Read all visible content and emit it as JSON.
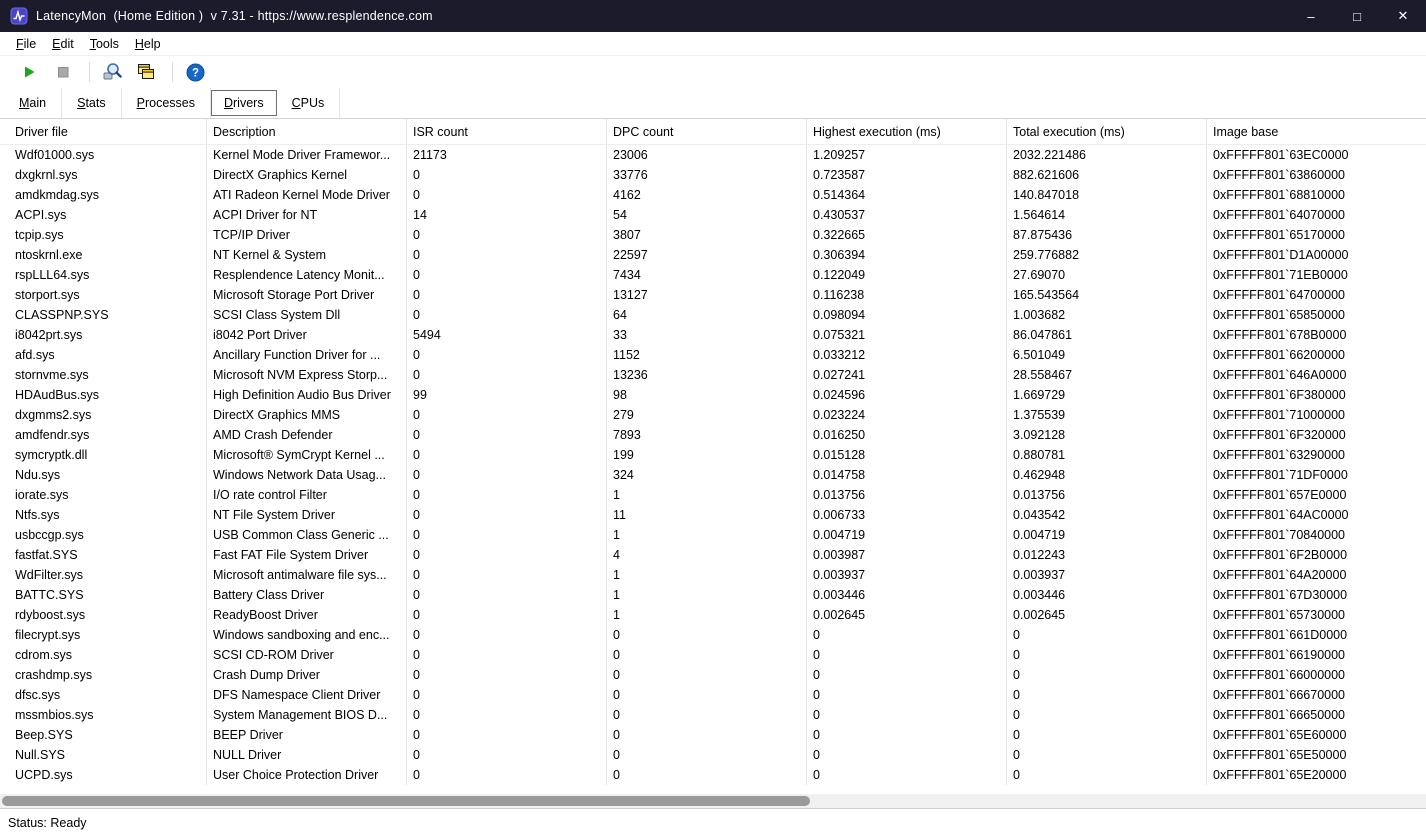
{
  "window": {
    "title": "LatencyMon  (Home Edition )  v 7.31 - https://www.resplendence.com",
    "controls": {
      "minimize": "–",
      "maximize": "□",
      "close": "✕"
    }
  },
  "menu": {
    "items": [
      "File",
      "Edit",
      "Tools",
      "Help"
    ]
  },
  "toolbar": {
    "buttons": [
      {
        "name": "start-monitor",
        "icon": "play-icon"
      },
      {
        "name": "stop-monitor",
        "icon": "stop-icon"
      },
      {
        "name": "analyze-drivers",
        "icon": "magnifier-tools-icon"
      },
      {
        "name": "report-windows",
        "icon": "cascade-windows-icon"
      },
      {
        "name": "help",
        "icon": "help-icon"
      }
    ]
  },
  "tabs": {
    "items": [
      "Main",
      "Stats",
      "Processes",
      "Drivers",
      "CPUs"
    ],
    "active": "Drivers"
  },
  "table": {
    "columns": [
      "Driver file",
      "Description",
      "ISR count",
      "DPC count",
      "Highest execution (ms)",
      "Total execution (ms)",
      "Image base"
    ],
    "rows": [
      [
        "Wdf01000.sys",
        "Kernel Mode Driver Framewor...",
        "21173",
        "23006",
        "1.209257",
        "2032.221486",
        "0xFFFFF801`63EC0000"
      ],
      [
        "dxgkrnl.sys",
        "DirectX Graphics Kernel",
        "0",
        "33776",
        "0.723587",
        "882.621606",
        "0xFFFFF801`63860000"
      ],
      [
        "amdkmdag.sys",
        "ATI Radeon Kernel Mode Driver",
        "0",
        "4162",
        "0.514364",
        "140.847018",
        "0xFFFFF801`68810000"
      ],
      [
        "ACPI.sys",
        "ACPI Driver for NT",
        "14",
        "54",
        "0.430537",
        "1.564614",
        "0xFFFFF801`64070000"
      ],
      [
        "tcpip.sys",
        "TCP/IP Driver",
        "0",
        "3807",
        "0.322665",
        "87.875436",
        "0xFFFFF801`65170000"
      ],
      [
        "ntoskrnl.exe",
        "NT Kernel & System",
        "0",
        "22597",
        "0.306394",
        "259.776882",
        "0xFFFFF801`D1A00000"
      ],
      [
        "rspLLL64.sys",
        "Resplendence Latency Monit...",
        "0",
        "7434",
        "0.122049",
        "27.69070",
        "0xFFFFF801`71EB0000"
      ],
      [
        "storport.sys",
        "Microsoft Storage Port Driver",
        "0",
        "13127",
        "0.116238",
        "165.543564",
        "0xFFFFF801`64700000"
      ],
      [
        "CLASSPNP.SYS",
        "SCSI Class System Dll",
        "0",
        "64",
        "0.098094",
        "1.003682",
        "0xFFFFF801`65850000"
      ],
      [
        "i8042prt.sys",
        "i8042 Port Driver",
        "5494",
        "33",
        "0.075321",
        "86.047861",
        "0xFFFFF801`678B0000"
      ],
      [
        "afd.sys",
        "Ancillary Function Driver for ...",
        "0",
        "1152",
        "0.033212",
        "6.501049",
        "0xFFFFF801`66200000"
      ],
      [
        "stornvme.sys",
        "Microsoft NVM Express Storp...",
        "0",
        "13236",
        "0.027241",
        "28.558467",
        "0xFFFFF801`646A0000"
      ],
      [
        "HDAudBus.sys",
        "High Definition Audio Bus Driver",
        "99",
        "98",
        "0.024596",
        "1.669729",
        "0xFFFFF801`6F380000"
      ],
      [
        "dxgmms2.sys",
        "DirectX Graphics MMS",
        "0",
        "279",
        "0.023224",
        "1.375539",
        "0xFFFFF801`71000000"
      ],
      [
        "amdfendr.sys",
        "AMD Crash Defender",
        "0",
        "7893",
        "0.016250",
        "3.092128",
        "0xFFFFF801`6F320000"
      ],
      [
        "symcryptk.dll",
        "Microsoft® SymCrypt Kernel ...",
        "0",
        "199",
        "0.015128",
        "0.880781",
        "0xFFFFF801`63290000"
      ],
      [
        "Ndu.sys",
        "Windows Network Data Usag...",
        "0",
        "324",
        "0.014758",
        "0.462948",
        "0xFFFFF801`71DF0000"
      ],
      [
        "iorate.sys",
        "I/O rate control Filter",
        "0",
        "1",
        "0.013756",
        "0.013756",
        "0xFFFFF801`657E0000"
      ],
      [
        "Ntfs.sys",
        "NT File System Driver",
        "0",
        "11",
        "0.006733",
        "0.043542",
        "0xFFFFF801`64AC0000"
      ],
      [
        "usbccgp.sys",
        "USB Common Class Generic ...",
        "0",
        "1",
        "0.004719",
        "0.004719",
        "0xFFFFF801`70840000"
      ],
      [
        "fastfat.SYS",
        "Fast FAT File System Driver",
        "0",
        "4",
        "0.003987",
        "0.012243",
        "0xFFFFF801`6F2B0000"
      ],
      [
        "WdFilter.sys",
        "Microsoft antimalware file sys...",
        "0",
        "1",
        "0.003937",
        "0.003937",
        "0xFFFFF801`64A20000"
      ],
      [
        "BATTC.SYS",
        "Battery Class Driver",
        "0",
        "1",
        "0.003446",
        "0.003446",
        "0xFFFFF801`67D30000"
      ],
      [
        "rdyboost.sys",
        "ReadyBoost Driver",
        "0",
        "1",
        "0.002645",
        "0.002645",
        "0xFFFFF801`65730000"
      ],
      [
        "filecrypt.sys",
        "Windows sandboxing and enc...",
        "0",
        "0",
        "0",
        "0",
        "0xFFFFF801`661D0000"
      ],
      [
        "cdrom.sys",
        "SCSI CD-ROM Driver",
        "0",
        "0",
        "0",
        "0",
        "0xFFFFF801`66190000"
      ],
      [
        "crashdmp.sys",
        "Crash Dump Driver",
        "0",
        "0",
        "0",
        "0",
        "0xFFFFF801`66000000"
      ],
      [
        "dfsc.sys",
        "DFS Namespace Client Driver",
        "0",
        "0",
        "0",
        "0",
        "0xFFFFF801`66670000"
      ],
      [
        "mssmbios.sys",
        "System Management BIOS D...",
        "0",
        "0",
        "0",
        "0",
        "0xFFFFF801`66650000"
      ],
      [
        "Beep.SYS",
        "BEEP Driver",
        "0",
        "0",
        "0",
        "0",
        "0xFFFFF801`65E60000"
      ],
      [
        "Null.SYS",
        "NULL Driver",
        "0",
        "0",
        "0",
        "0",
        "0xFFFFF801`65E50000"
      ],
      [
        "UCPD.sys",
        "User Choice Protection Driver",
        "0",
        "0",
        "0",
        "0",
        "0xFFFFF801`65E20000"
      ]
    ]
  },
  "statusbar": {
    "text": "Status: Ready"
  }
}
